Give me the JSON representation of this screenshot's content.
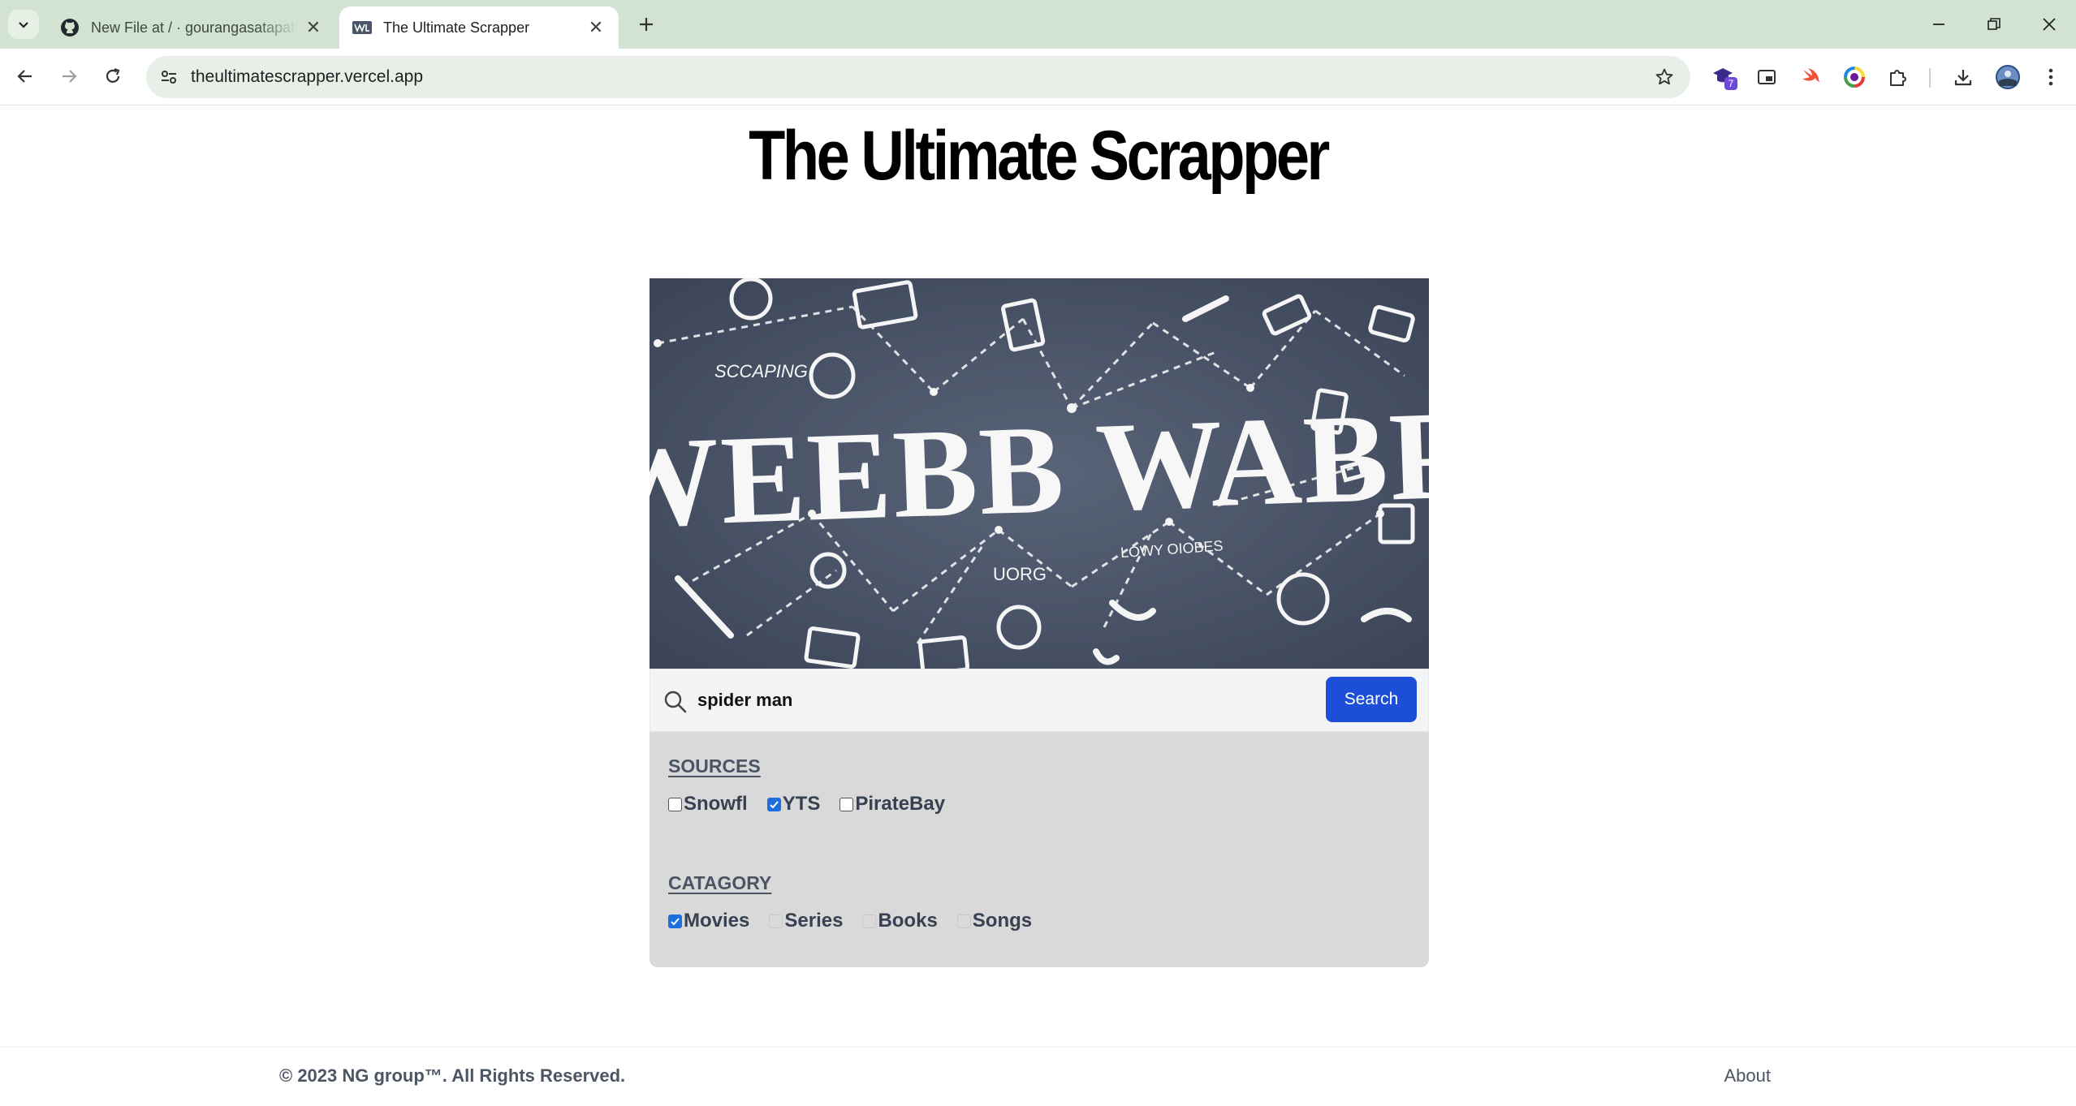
{
  "browser": {
    "tabs": [
      {
        "title": "New File at / · gourangasatapathy",
        "favicon": "github-icon",
        "active": false
      },
      {
        "title": "The Ultimate Scrapper",
        "favicon": "site-favicon-icon",
        "active": true
      }
    ],
    "url": "theultimatescrapper.vercel.app",
    "extension_badge": "7"
  },
  "page": {
    "title": "The Ultimate Scrapper",
    "banner": {
      "main_text": "WEEBB WABP",
      "scribble_1": "SCCAPING",
      "scribble_2": "UORG",
      "scribble_3": "LOWY OIOBES"
    },
    "search": {
      "value": "spider man",
      "placeholder": "",
      "button_label": "Search"
    },
    "sources": {
      "heading": "SOURCES",
      "options": [
        {
          "label": "Snowfl",
          "checked": false
        },
        {
          "label": "YTS",
          "checked": true
        },
        {
          "label": "PirateBay",
          "checked": false
        }
      ]
    },
    "category": {
      "heading": "CATAGORY",
      "options": [
        {
          "label": "Movies",
          "checked": true
        },
        {
          "label": "Series",
          "checked": false
        },
        {
          "label": "Books",
          "checked": false
        },
        {
          "label": "Songs",
          "checked": false
        }
      ]
    },
    "footer": {
      "copyright": "© 2023 NG group™. All Rights Reserved.",
      "about": "About"
    }
  },
  "colors": {
    "tabstrip": "#d3e3d2",
    "search_button": "#1d4ed8",
    "checkbox_checked": "#1d6fe0",
    "card_bg": "#d9d9d9",
    "banner_bg": "#4a5568"
  }
}
